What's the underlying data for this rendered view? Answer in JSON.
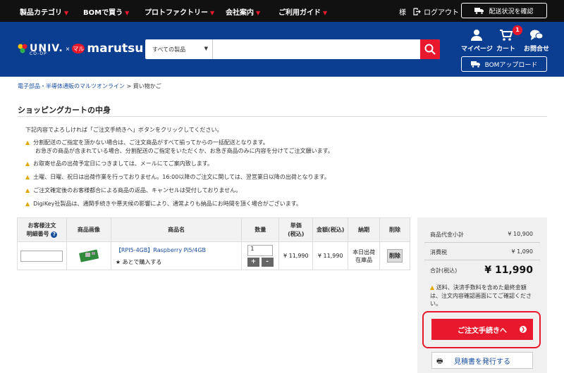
{
  "topnav": {
    "items": [
      "製品カテゴリ",
      "BOMで買う",
      "プロトファクトリー",
      "会社案内",
      "ご利用ガイド"
    ],
    "user": "様",
    "logout": "ログアウト",
    "ship_status": "配送状況を確認"
  },
  "header": {
    "logo_univ": "UNIV.",
    "logo_coop": "CO-OP",
    "logo_x": "×",
    "logo_badge": "マル",
    "logo_marutsu": "marutsu",
    "search_category": "すべての製品",
    "search_placeholder": "",
    "mypage": "マイページ",
    "cart": "カート",
    "cart_count": "1",
    "contact": "お問合せ",
    "bom_upload": "BOMアップロード"
  },
  "breadcrumb": {
    "home": "電子部品・半導体通販のマルツオンライン",
    "sep": " > ",
    "current": "買い物かご"
  },
  "page_title": "ショッピングカートの中身",
  "notes": {
    "intro": "下記内容でよろしければ「ご注文手続きへ」ボタンをクリックしてください。",
    "n1a": "分割配送のご指定を頂かない場合は、ご注文商品がすべて揃ってからの一括配送となります。",
    "n1b": "お急ぎの商品が含まれている場合、分割配送のご指定をいただくか、お急ぎ商品のみに内容を分けてご注文願います。",
    "n2": "お取寄せ品の出荷予定日につきましては、メールにてご案内致します。",
    "n3": "土曜、日曜、祝日は出荷作業を行っておりません。16:00以降のご注文に関しては、翌営業日以降の出荷となります。",
    "n4": "ご注文確定後のお客様都合による商品の返品、キャンセルは受付しておりません。",
    "n5": "DigiKey社製品は、通関手続きや悪天候の影響により、通常よりも納品にお時間を頂く場合がございます。"
  },
  "table": {
    "headers": {
      "custom_no_1": "お客様注文",
      "custom_no_2": "明細番号",
      "image": "商品画像",
      "name": "商品名",
      "qty": "数量",
      "unit_1": "単価",
      "unit_2": "(税込)",
      "amount": "金額(税込)",
      "delivery": "納期",
      "delete": "削除"
    },
    "row": {
      "name": "【RPI5-4GB】Raspberry Pi5/4GB",
      "buy_later": "あとで購入する",
      "qty": "1",
      "plus": "+",
      "minus": "-",
      "unit_price": "¥ 11,990",
      "amount": "¥ 11,990",
      "delivery_1": "本日出荷",
      "delivery_2": "在庫品",
      "delete": "削除"
    }
  },
  "summary": {
    "subtotal_label": "商品代金小計",
    "subtotal": "¥ 10,900",
    "tax_label": "消費税",
    "tax": "¥ 1,090",
    "total_label": "合計(税込)",
    "total": "¥ 11,990",
    "warning": "送料、決済手数料を含めた最終金額は、注文内容確認画面にてご確認ください。",
    "checkout": "ご注文手続きへ",
    "quote": "見積書を発行する"
  },
  "colors": {
    "brand_red": "#e8192c",
    "brand_blue": "#0b3d91",
    "warning": "#e0a800"
  }
}
